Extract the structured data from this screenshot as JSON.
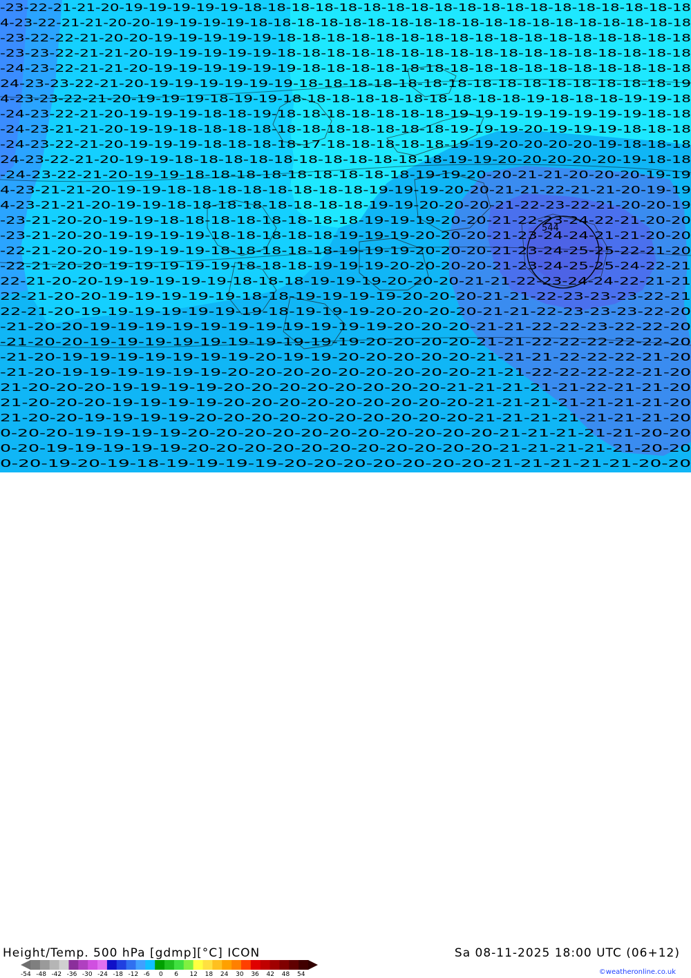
{
  "map": {
    "title_left": "Height/Temp. 500 hPa [gdmp][°C] ICON",
    "title_right": "Sa 08-11-2025 18:00 UTC (06+12)",
    "credit": "©weatheronline.co.uk",
    "low_center_label": "544",
    "colorbar": {
      "ticks": [
        "-54",
        "-48",
        "-42",
        "-36",
        "-30",
        "-24",
        "-18",
        "-12",
        "-6",
        "0",
        "6",
        "12",
        "18",
        "24",
        "30",
        "36",
        "42",
        "48",
        "54"
      ],
      "colors": [
        "#7f7f7f",
        "#9a9a9a",
        "#b5b5b5",
        "#d0d0d0",
        "#8b2f9b",
        "#b040c0",
        "#d050e0",
        "#e070f0",
        "#1010c8",
        "#2040e0",
        "#3070f0",
        "#40a0ff",
        "#10c0ff",
        "#00a000",
        "#20c020",
        "#40e040",
        "#80f040",
        "#ffff40",
        "#ffe040",
        "#ffc020",
        "#ffa000",
        "#ff8000",
        "#ff4000",
        "#e00000",
        "#c00000",
        "#a00000",
        "#800000",
        "#600000",
        "#400000"
      ]
    },
    "rows": [
      "-23-22-21-21-20-19-19-19-19-19-18-18-18-18-18-18-18-18-18-18-18-18-18-18-18-18-18-18-18",
      "4-23-22-21-21-20-20-19-19-19-19-18-18-18-18-18-18-18-18-18-18-18-18-18-18-18-18-18-18-18",
      "-23-22-22-21-20-20-19-19-19-19-19-18-18-18-18-18-18-18-18-18-18-18-18-18-18-18-18-18",
      "-23-23-22-21-21-20-19-19-19-19-19-18-18-18-18-18-18-18-18-18-18-18-18-18-18-18-18-18",
      "-24-23-22-21-21-20-19-19-19-19-19-19-18-18-18-18-18-18-18-18-18-18-18-18-18-18-18-18",
      "24-23-23-22-21-20-19-19-19-19-19-19-18-18-18-18-18-18-18-18-18-18-18-18-18-18-18-19",
      "4-23-23-22-21-20-19-19-19-18-19-19-18-18-18-18-18-18-18-18-18-18-19-18-18-18-19-19-18",
      "-24-23-22-21-20-19-19-19-18-18-19-18-18-18-18-18-18-18-19-19-19-19-19-19-19-19-18-18",
      "-24-23-21-21-20-19-19-18-18-18-18-18-18-18-18-18-18-18-19-19-19-20-19-19-19-18-18-18",
      "-24-23-22-21-20-19-19-19-18-18-18-18-17-18-18-18-18-18-19-19-20-20-20-20-19-18-18-18",
      "24-23-22-21-20-19-19-18-18-18-18-18-18-18-18-18-18-18-19-19-20-20-20-20-20-19-18-18",
      "-24-23-22-21-20-19-19-18-18-18-18-18-18-18-18-18-19-19-20-20-21-21-20-20-20-19-19",
      "4-23-21-21-20-19-19-18-18-18-18-18-18-18-18-19-19-19-20-20-21-21-22-21-21-20-19-19",
      "4-23-21-21-20-19-19-18-18-18-18-18-18-18-18-19-19-20-20-20-21-22-23-22-21-20-20-19",
      "-23-21-20-20-19-19-18-18-18-18-18-18-18-18-19-19-19-20-20-21-22-23-24-22-21-20-20",
      "-23-21-20-20-19-19-19-19-18-18-18-18-18-19-19-19-20-20-20-21-23-24-24-21-21-20-20",
      "-22-21-20-20-19-19-19-19-18-18-18-18-18-19-19-19-20-20-20-21-23-24-25-25-22-21-20",
      "-22-21-20-20-19-19-19-19-19-18-18-18-19-19-19-20-20-20-20-21-23-24-25-25-24-22-21",
      "22-21-20-20-19-19-19-19-19-18-18-18-19-19-19-20-20-20-21-21-22-23-24-24-22-21-21",
      "22-21-20-20-19-19-19-19-19-18-18-19-19-19-19-20-20-20-21-21-22-23-23-23-22-21",
      "22-21-20-19-19-19-19-19-19-19-18-19-19-19-20-20-20-20-21-21-22-23-23-23-22-20",
      "-21-20-20-19-19-19-19-19-19-19-19-19-19-19-20-20-20-21-21-22-22-23-22-22-20",
      "-21-20-20-19-19-19-19-19-19-19-19-19-19-20-20-20-20-21-21-22-22-22-22-22-20",
      "-21-20-19-19-19-19-19-19-19-20-19-19-20-20-20-20-20-21-21-21-22-22-22-21-20",
      "-21-20-19-19-19-19-19-19-20-20-20-20-20-20-20-20-20-21-21-22-22-22-22-21-20",
      "21-20-20-20-19-19-19-19-20-20-20-20-20-20-20-20-21-21-21-21-21-22-21-21-20",
      "21-20-20-20-19-19-19-19-20-20-20-20-20-20-20-20-20-21-21-21-21-21-21-21-20",
      "21-20-20-19-19-19-19-20-20-20-20-20-20-20-20-20-20-21-21-21-21-21-21-21-20",
      "0-20-20-19-19-19-19-20-20-20-20-20-20-20-20-20-20-20-21-21-21-21-21-20-20",
      "0-20-19-19-19-19-19-20-20-20-20-20-20-20-20-20-20-20-21-21-21-21-21-20-20",
      "0-20-19-20-19-18-19-19-19-19-20-20-20-20-20-20-20-21-21-21-21-21-20-20"
    ]
  }
}
